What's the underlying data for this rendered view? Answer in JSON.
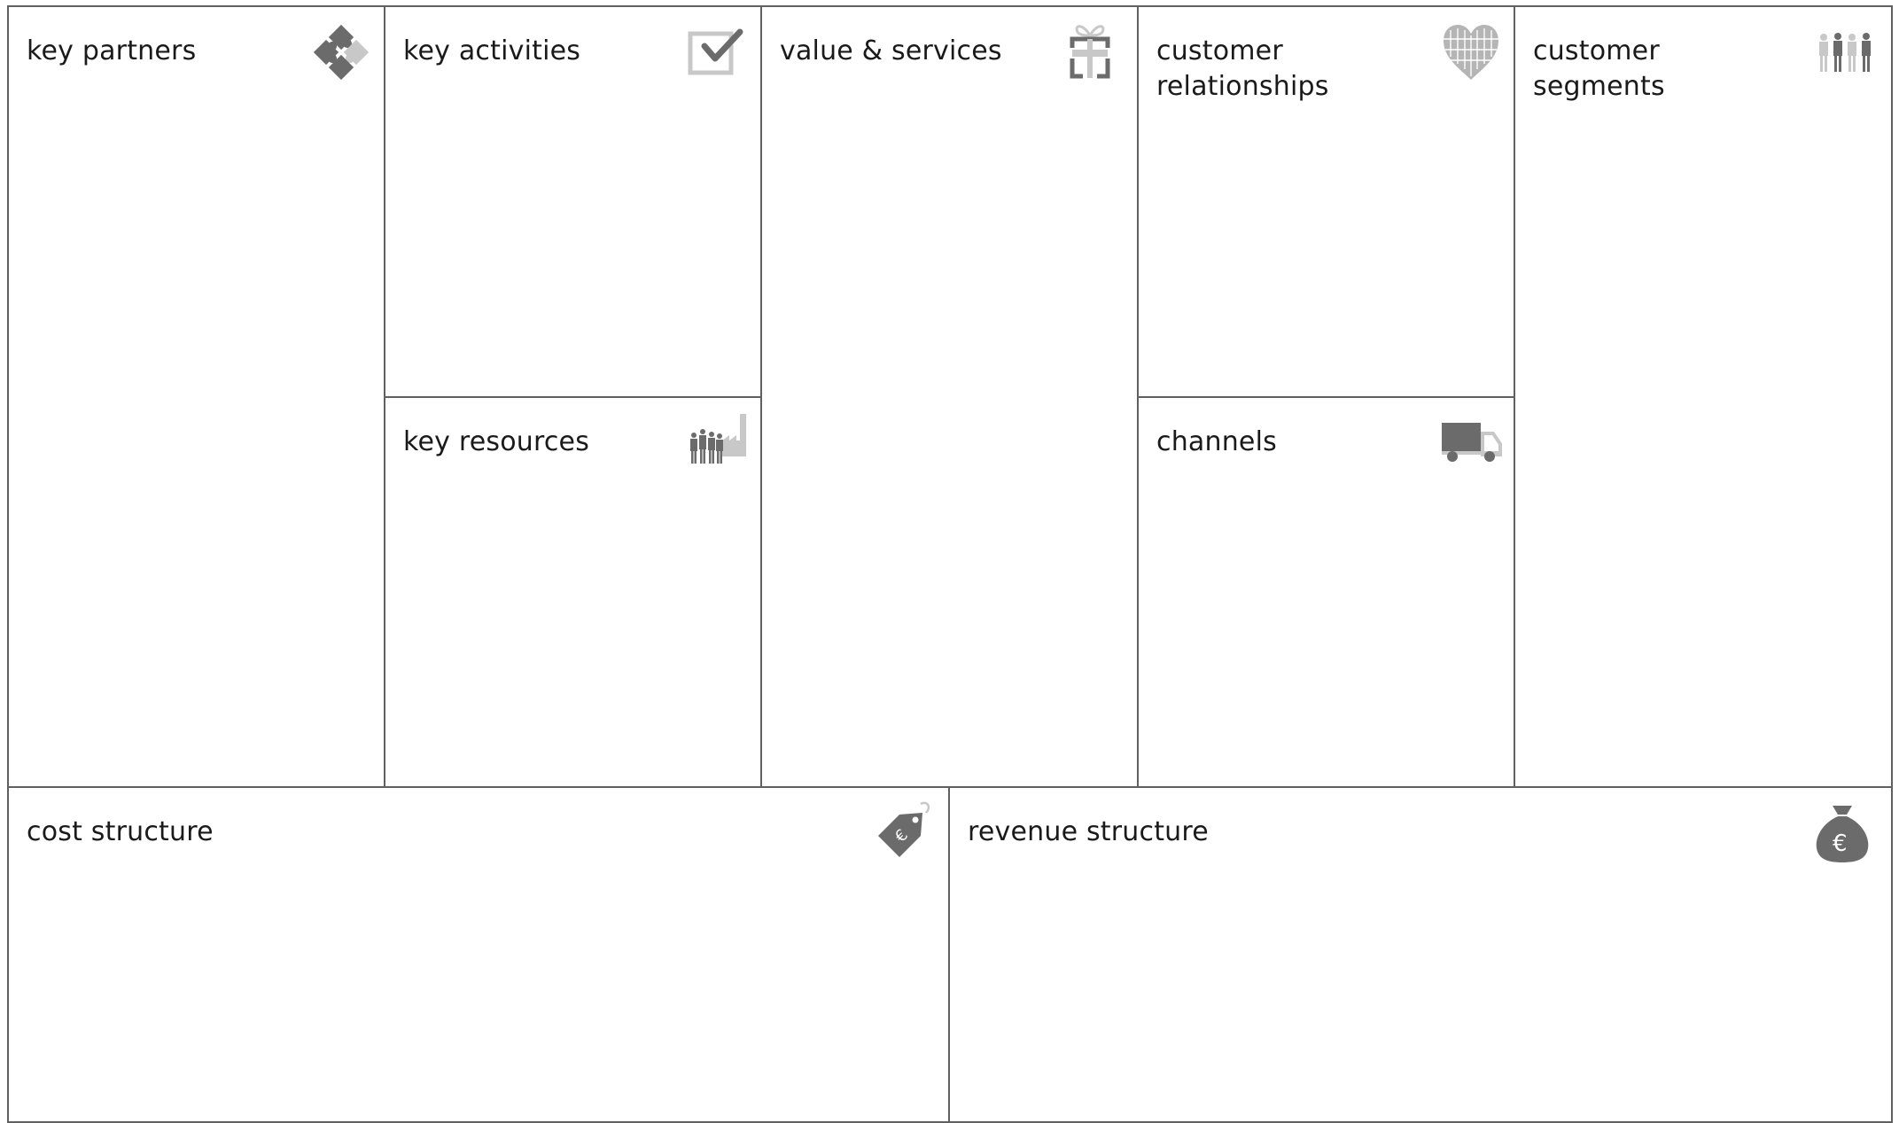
{
  "canvas": {
    "key_partners": {
      "title": "key partners",
      "icon": "puzzle-icon"
    },
    "key_activities": {
      "title": "key activities",
      "icon": "checkbox-icon"
    },
    "key_resources": {
      "title": "key resources",
      "icon": "people-factory-icon"
    },
    "value_services": {
      "title": "value & services",
      "icon": "gift-icon"
    },
    "customer_relationships": {
      "title": "customer\nrelationships",
      "icon": "heart-people-icon"
    },
    "channels": {
      "title": "channels",
      "icon": "truck-icon"
    },
    "customer_segments": {
      "title": "customer\nsegments",
      "icon": "people-group-icon"
    },
    "cost_structure": {
      "title": "cost structure",
      "icon": "price-tag-icon"
    },
    "revenue_structure": {
      "title": "revenue structure",
      "icon": "money-bag-icon"
    }
  },
  "colors": {
    "border": "#606060",
    "icon_dark": "#6b6b6b",
    "icon_light": "#c8c8c8",
    "text": "#1a1a1a"
  }
}
